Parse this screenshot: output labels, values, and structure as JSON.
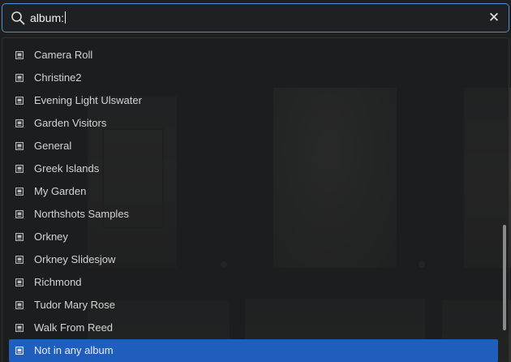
{
  "search": {
    "query": "album:",
    "icon": "search-icon",
    "clear_icon": "close-icon",
    "clear_glyph": "✕"
  },
  "dropdown": {
    "items": [
      {
        "label": "Camera Roll",
        "icon": "album-icon",
        "selected": false
      },
      {
        "label": "Christine2",
        "icon": "album-icon",
        "selected": false
      },
      {
        "label": "Evening Light Ulswater",
        "icon": "album-icon",
        "selected": false
      },
      {
        "label": "Garden Visitors",
        "icon": "album-icon",
        "selected": false
      },
      {
        "label": "General",
        "icon": "album-icon",
        "selected": false
      },
      {
        "label": "Greek Islands",
        "icon": "album-icon",
        "selected": false
      },
      {
        "label": "My Garden",
        "icon": "album-icon",
        "selected": false
      },
      {
        "label": "Northshots Samples",
        "icon": "album-icon",
        "selected": false
      },
      {
        "label": "Orkney",
        "icon": "album-icon",
        "selected": false
      },
      {
        "label": "Orkney Slidesjow",
        "icon": "album-icon",
        "selected": false
      },
      {
        "label": "Richmond",
        "icon": "album-icon",
        "selected": false
      },
      {
        "label": "Tudor Mary Rose",
        "icon": "album-icon",
        "selected": false
      },
      {
        "label": "Walk From Reed",
        "icon": "album-icon",
        "selected": false
      },
      {
        "label": "Not in any album",
        "icon": "album-icon",
        "selected": true
      }
    ]
  },
  "colors": {
    "accent": "#1f5ebd",
    "focus_border": "#4b8fd6",
    "background": "#1e1f21",
    "text": "#d4d4d4"
  }
}
